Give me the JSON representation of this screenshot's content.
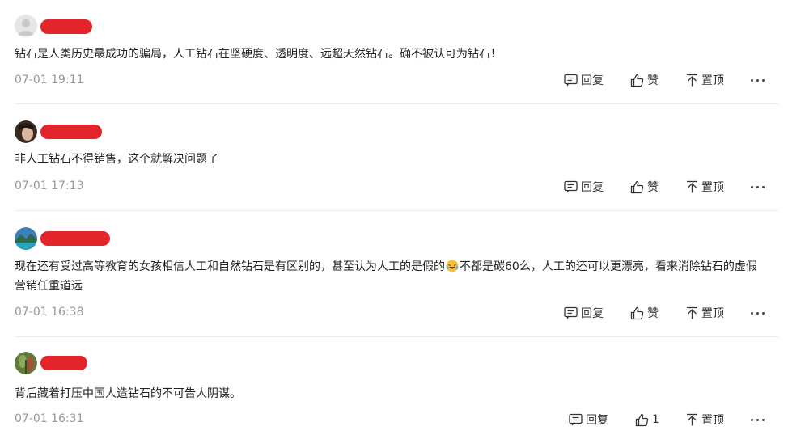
{
  "comments": [
    {
      "avatar": "default-avatar",
      "text": "钻石是人类历史最成功的骗局，人工钻石在坚硬度、透明度、远超天然钻石。确不被认可为钻石！",
      "time": "07-01 19:11",
      "reply_label": "回复",
      "like_label": "赞",
      "pin_label": "置顶"
    },
    {
      "avatar": "user-photo-avatar",
      "text": "非人工钻石不得销售，这个就解决问题了",
      "time": "07-01 17:13",
      "reply_label": "回复",
      "like_label": "赞",
      "pin_label": "置顶"
    },
    {
      "avatar": "landscape-avatar",
      "text_before_emoji": "现在还有受过高等教育的女孩相信人工和自然钻石是有区别的，甚至认为人工的是假的",
      "emoji": "laugh-cry-emoji",
      "text_after_emoji": "不都是碳60么，人工的还可以更漂亮，看来消除钻石的虚假营销任重道远",
      "time": "07-01 16:38",
      "reply_label": "回复",
      "like_label": "赞",
      "pin_label": "置顶"
    },
    {
      "avatar": "plant-avatar",
      "text": "背后藏着打压中国人造钻石的不可告人阴谋。",
      "time": "07-01 16:31",
      "reply_label": "回复",
      "like_label": "1",
      "pin_label": "置顶"
    }
  ],
  "colors": {
    "username_redaction": "#e2242b",
    "text": "#222222",
    "time": "#999999",
    "divider": "#ececec"
  }
}
